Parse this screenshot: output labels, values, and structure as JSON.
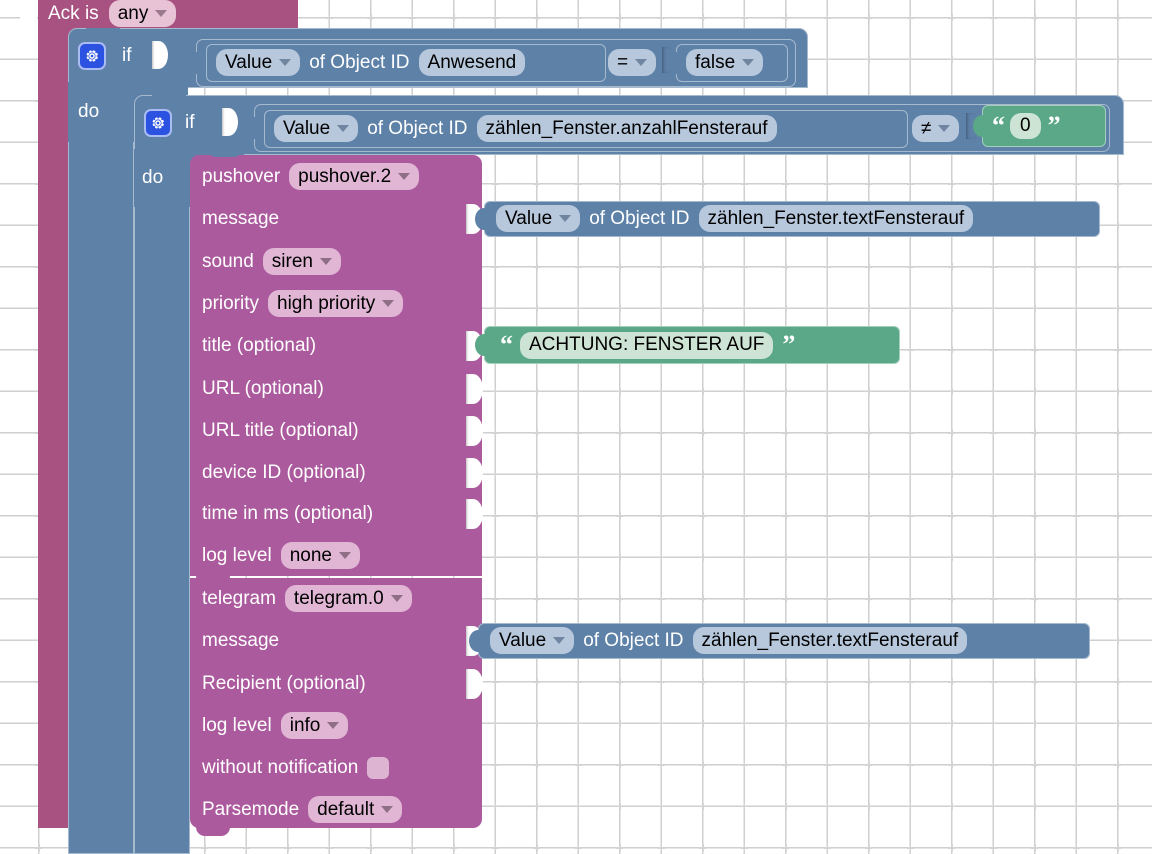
{
  "app": {
    "name": "blockly-workspace",
    "title": "ioBroker Blockly Script Editor"
  },
  "colors": {
    "trigger_magenta": "#a8527f",
    "logic_blue": "#5e81a8",
    "sendto_purple": "#ab5a9d",
    "text_green": "#5aa888",
    "mutator_blue": "#2b52e0",
    "field_purple": "#e0b6d4",
    "field_blue": "#b7c8dc",
    "field_green": "#cde3d4",
    "workspace_bg": "#ffffff",
    "grid_dot": "#d4d4d4"
  },
  "blocks": {
    "trigger": {
      "label": "Ack is",
      "ack_value": "any"
    },
    "if_outer": {
      "mutator_icon": "gear-icon",
      "if_label": "if",
      "do_label": "do",
      "condition": {
        "attribute": "Value",
        "of_label": "of Object ID",
        "object_id": "Anwesend",
        "operator": "=",
        "compare_value": "false"
      }
    },
    "if_inner": {
      "mutator_icon": "gear-icon",
      "if_label": "if",
      "do_label": "do",
      "condition": {
        "attribute": "Value",
        "of_label": "of Object ID",
        "object_id": "zählen_Fenster.anzahlFensterauf",
        "operator": "≠",
        "compare_value": "0",
        "compare_value_type": "text"
      }
    },
    "pushover": {
      "title": "pushover",
      "instance": "pushover.2",
      "rows": [
        {
          "label": "message",
          "field": null,
          "socket": true,
          "value_block": "value_message_pushover"
        },
        {
          "label": "sound",
          "field": "siren",
          "socket": false
        },
        {
          "label": "priority",
          "field": "high priority",
          "socket": false
        },
        {
          "label": "title (optional)",
          "field": null,
          "socket": true,
          "value_block": "text_title"
        },
        {
          "label": "URL (optional)",
          "field": null,
          "socket": true
        },
        {
          "label": "URL title (optional)",
          "field": null,
          "socket": true
        },
        {
          "label": "device ID (optional)",
          "field": null,
          "socket": true
        },
        {
          "label": "time in ms (optional)",
          "field": null,
          "socket": true
        },
        {
          "label": "log level",
          "field": "none",
          "socket": false
        }
      ]
    },
    "telegram": {
      "title": "telegram",
      "instance": "telegram.0",
      "rows": [
        {
          "label": "message",
          "field": null,
          "socket": true,
          "value_block": "value_message_telegram"
        },
        {
          "label": "Recipient (optional)",
          "field": null,
          "socket": true
        },
        {
          "label": "log level",
          "field": "info",
          "socket": false
        },
        {
          "label": "without notification",
          "field": null,
          "socket": false,
          "checkbox": true,
          "checked": false
        },
        {
          "label": "Parsemode",
          "field": "default",
          "socket": false
        }
      ]
    },
    "value_message_pushover": {
      "attribute": "Value",
      "of_label": "of Object ID",
      "object_id": "zählen_Fenster.textFensterauf"
    },
    "value_message_telegram": {
      "attribute": "Value",
      "of_label": "of Object ID",
      "object_id": "zählen_Fenster.textFensterauf"
    },
    "text_title": {
      "open_quote": "“",
      "text": "ACHTUNG: FENSTER AUF",
      "close_quote": "”"
    }
  }
}
